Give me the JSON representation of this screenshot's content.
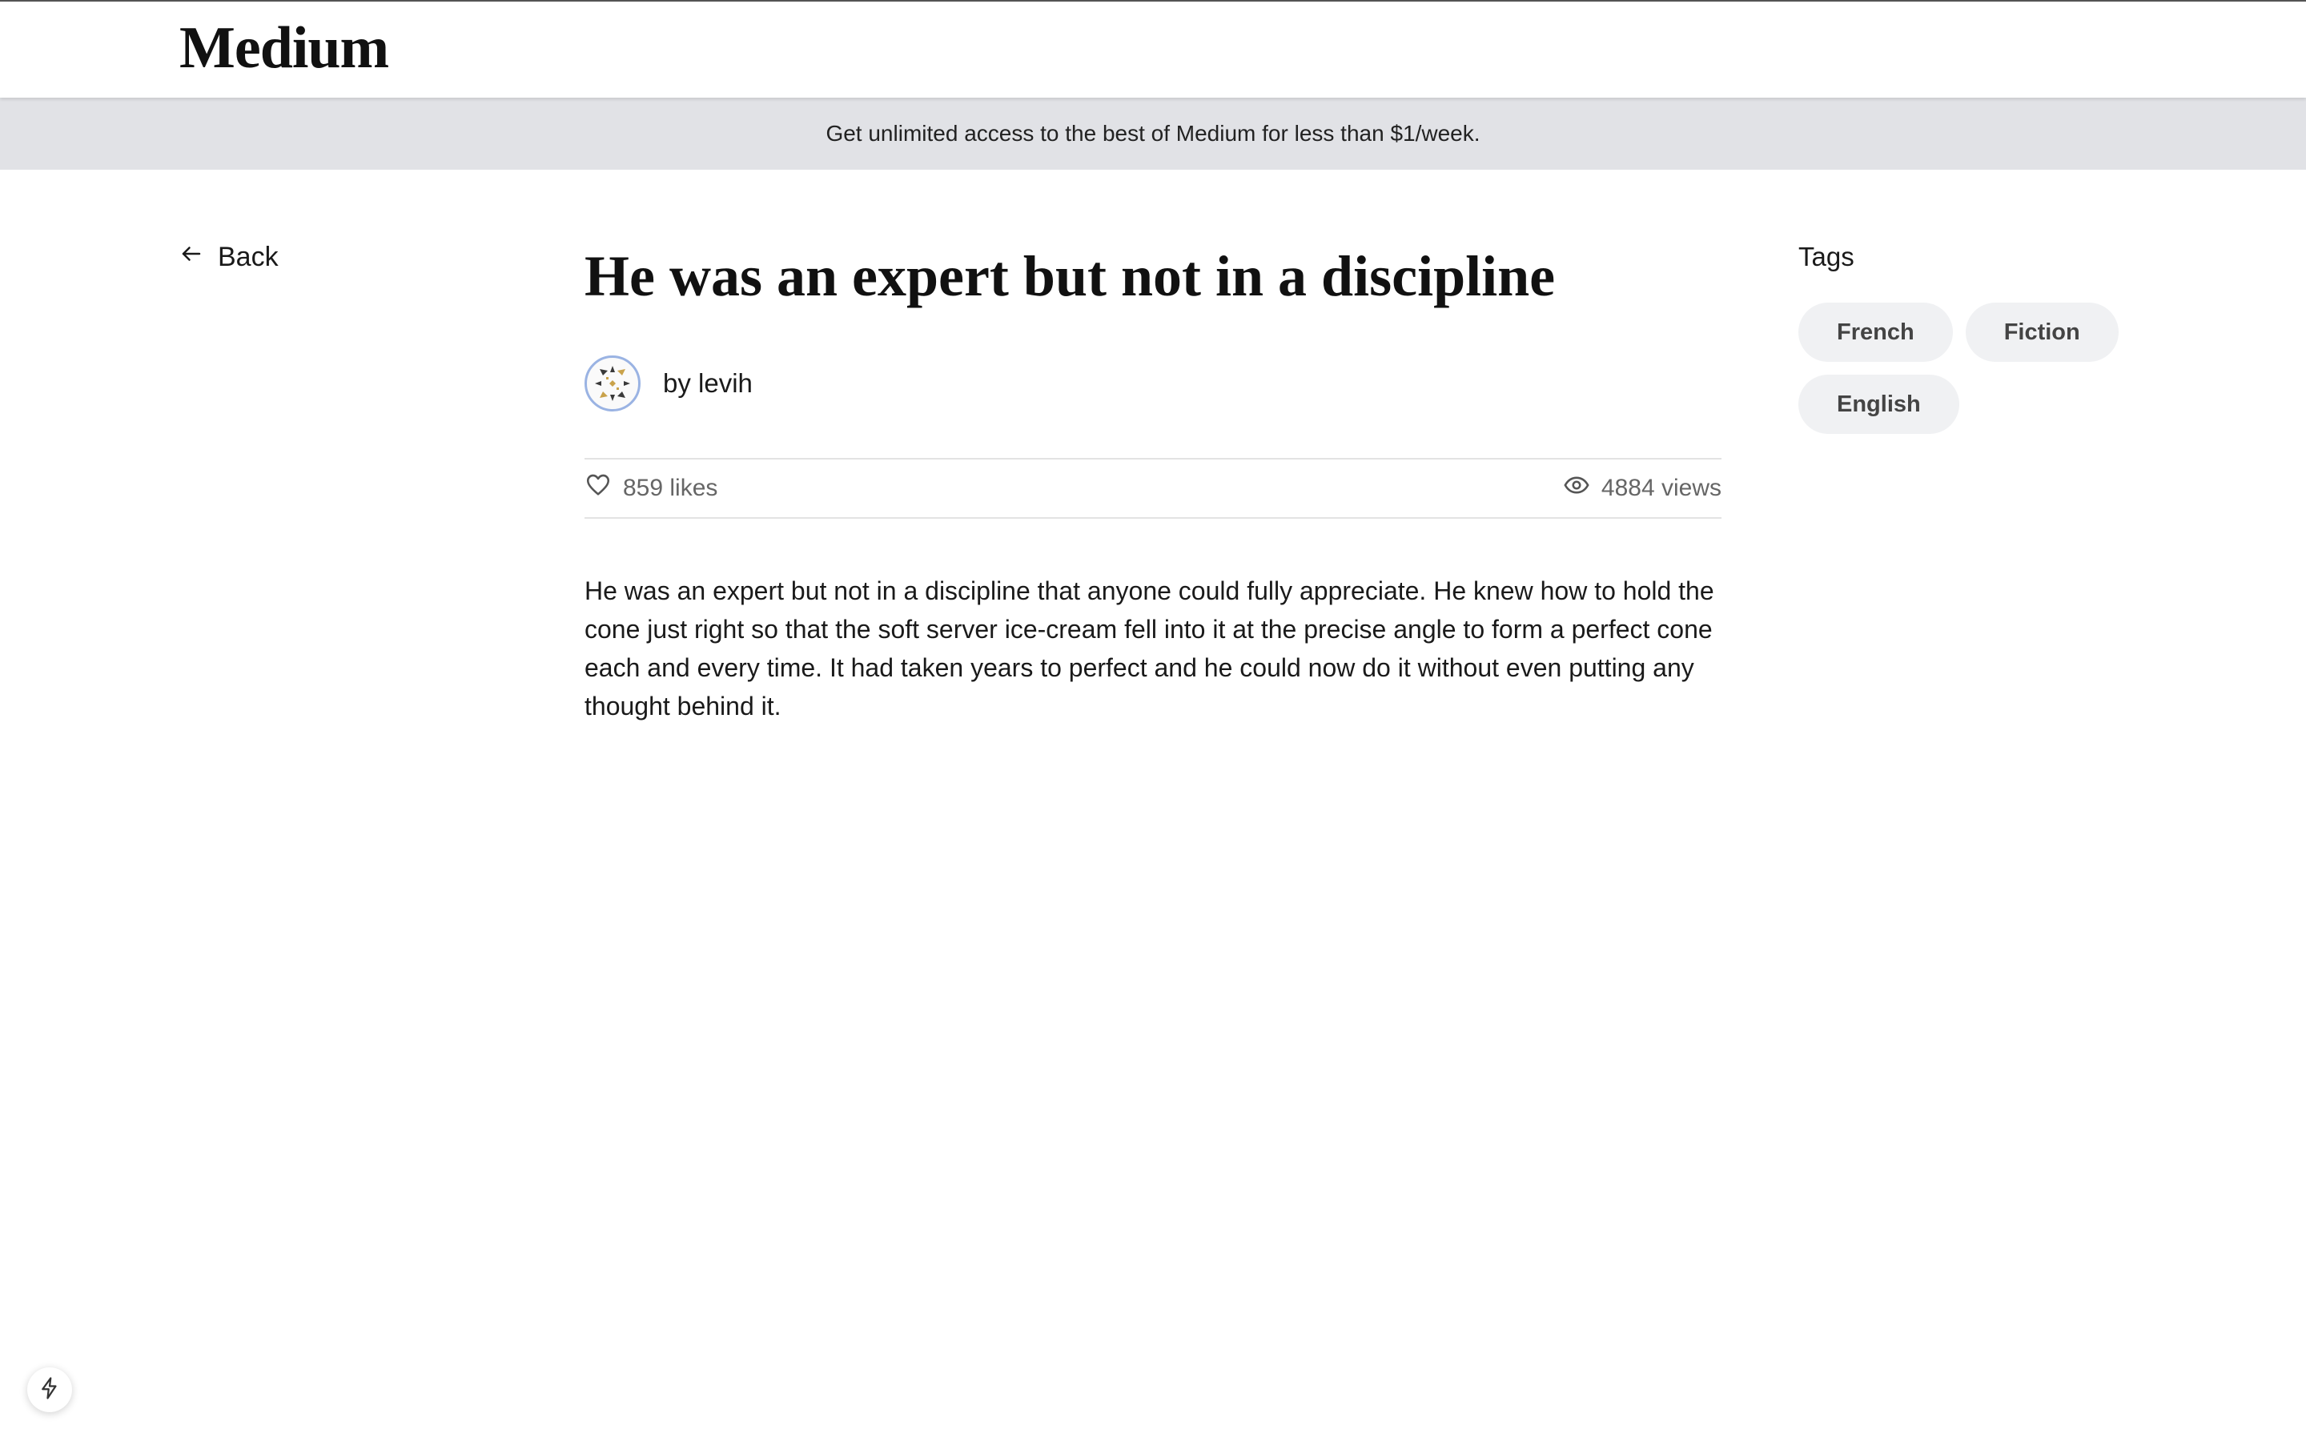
{
  "header": {
    "logo": "Medium"
  },
  "banner": {
    "text": "Get unlimited access to the best of Medium for less than $1/week."
  },
  "nav": {
    "back_label": "Back",
    "back_icon": "arrow-left-icon"
  },
  "article": {
    "title": "He was an expert but not in a discipline",
    "author": "by levih",
    "avatar_icon": "avatar-pattern-icon",
    "likes": "859 likes",
    "views": "4884 views",
    "like_icon": "heart-icon",
    "view_icon": "eye-icon",
    "body": "He was an expert but not in a discipline that anyone could fully appreciate. He knew how to hold the cone just right so that the soft server ice-cream fell into it at the precise angle to form a perfect cone each and every time. It had taken years to perfect and he could now do it without even putting any thought behind it."
  },
  "tags": {
    "heading": "Tags",
    "items": [
      "French",
      "Fiction",
      "English"
    ]
  },
  "floating_button": {
    "icon": "lightning-icon"
  },
  "colors": {
    "banner_bg": "#e1e2e6",
    "tag_bg": "#f0f1f3",
    "muted_text": "#666666",
    "avatar_border": "#9ab3e3"
  }
}
